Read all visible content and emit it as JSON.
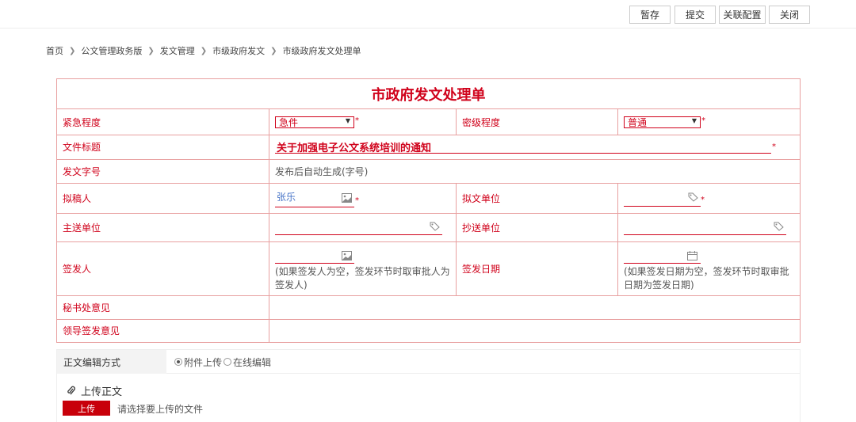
{
  "toolbar": {
    "save_label": "暂存",
    "submit_label": "提交",
    "link_config_label": "关联配置",
    "close_label": "关闭"
  },
  "breadcrumb": [
    "首页",
    "公文管理政务版",
    "发文管理",
    "市级政府发文",
    "市级政府发文处理单"
  ],
  "form": {
    "title": "市政府发文处理单",
    "urgency": {
      "label": "紧急程度",
      "value": "急件"
    },
    "secrecy": {
      "label": "密级程度",
      "value": "普通"
    },
    "doc_title": {
      "label": "文件标题",
      "value": "关于加强电子公文系统培训的通知"
    },
    "doc_number": {
      "label": "发文字号",
      "value": "发布后自动生成(字号)"
    },
    "drafter": {
      "label": "拟稿人",
      "value": "张乐"
    },
    "draft_unit": {
      "label": "拟文单位",
      "value": ""
    },
    "main_recipient": {
      "label": "主送单位",
      "value": ""
    },
    "cc_unit": {
      "label": "抄送单位",
      "value": ""
    },
    "signer": {
      "label": "签发人",
      "hint": "(如果签发人为空，签发环节时取审批人为签发人)"
    },
    "sign_date": {
      "label": "签发日期",
      "hint": "(如果签发日期为空，签发环节时取审批日期为签发日期)"
    },
    "secretary_opinion": {
      "label": "秘书处意见"
    },
    "leader_opinion": {
      "label": "领导签发意见"
    },
    "required_mark": "*"
  },
  "editor": {
    "mode_label": "正文编辑方式",
    "option_attachment": "附件上传",
    "option_online": "在线编辑",
    "selected": "附件上传",
    "upload_title": "上传正文",
    "upload_button": "上传",
    "upload_hint": "请选择要上传的文件"
  },
  "colors": {
    "accent": "#d0021b",
    "border": "#e8a0a0",
    "button": "#c8000a"
  }
}
